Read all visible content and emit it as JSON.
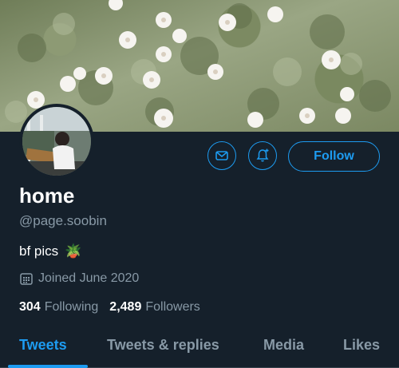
{
  "profile": {
    "name": "home",
    "handle": "@page.soobin",
    "bio_text": "bf pics",
    "bio_emoji": "🪴",
    "joined": "Joined June 2020",
    "following_count": "304",
    "following_label": "Following",
    "followers_count": "2,489",
    "followers_label": "Followers"
  },
  "actions": {
    "message_icon": "mail-icon",
    "notify_icon": "bell-plus-icon",
    "follow_label": "Follow"
  },
  "tabs": [
    {
      "label": "Tweets",
      "active": true
    },
    {
      "label": "Tweets & replies",
      "active": false
    },
    {
      "label": "Media",
      "active": false
    },
    {
      "label": "Likes",
      "active": false
    }
  ],
  "colors": {
    "background": "#15202b",
    "accent": "#1d9bf0",
    "muted_text": "#8899a6"
  }
}
